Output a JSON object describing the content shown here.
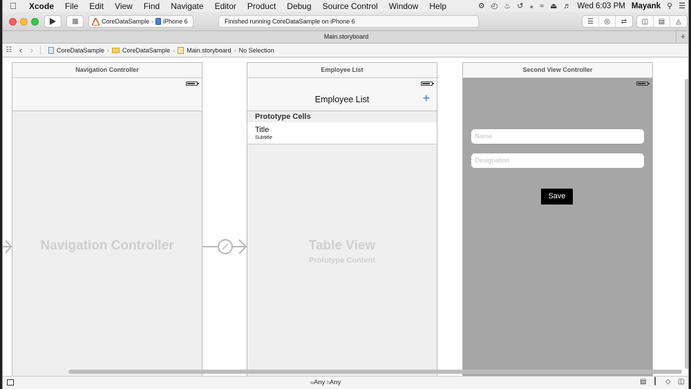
{
  "menubar": {
    "apple_icon": "apple-logo-icon",
    "app_name": "Xcode",
    "items": [
      "File",
      "Edit",
      "View",
      "Find",
      "Navigate",
      "Editor",
      "Product",
      "Debug",
      "Source Control",
      "Window",
      "Help"
    ],
    "clock": "Wed 6:03 PM",
    "user": "Mayank"
  },
  "toolbar": {
    "scheme": "CoreDataSample",
    "device": "iPhone 6",
    "activity": "Finished running CoreDataSample on iPhone 6"
  },
  "tab": {
    "title": "Main.storyboard"
  },
  "jumpbar": {
    "project": "CoreDataSample",
    "group": "CoreDataSample",
    "file": "Main.storyboard",
    "selection": "No Selection"
  },
  "scenes": {
    "nav": {
      "header": "Navigation Controller",
      "placeholder": "Navigation Controller"
    },
    "list": {
      "header": "Employee List",
      "nav_title": "Employee List",
      "section": "Prototype Cells",
      "cell_title": "Title",
      "cell_subtitle": "Subtitle",
      "placeholder": "Table View",
      "placeholder_sub": "Prototype Content"
    },
    "second": {
      "header": "Second View Controller",
      "name_placeholder": "Name",
      "designation_placeholder": "Designation",
      "save": "Save"
    }
  },
  "statusbar": {
    "w_prefix": "w",
    "w_value": "Any",
    "h_prefix": "h",
    "h_value": "Any"
  },
  "colors": {
    "canvas": "#ffffff",
    "scene_bg": "#efefef",
    "second_view_bg": "#a6a6a6",
    "accent": "#2f7df6"
  }
}
